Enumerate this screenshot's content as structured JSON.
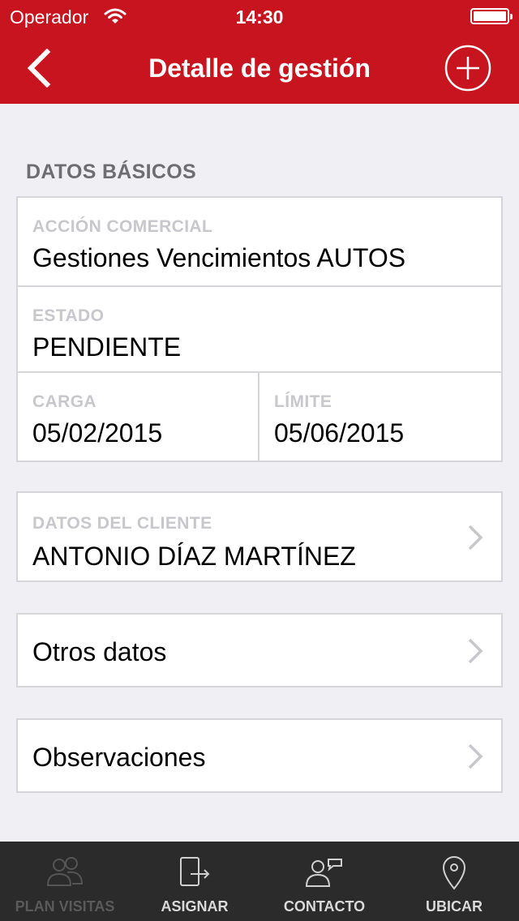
{
  "status_bar": {
    "carrier": "Operador",
    "time": "14:30"
  },
  "nav": {
    "title": "Detalle de gestión",
    "back_icon": "chevron-left-icon",
    "add_icon": "plus-circle-icon"
  },
  "section": {
    "title": "DATOS BÁSICOS"
  },
  "basic": {
    "action_label": "ACCIÓN COMERCIAL",
    "action_value": "Gestiones Vencimientos AUTOS",
    "state_label": "ESTADO",
    "state_value": "PENDIENTE",
    "load_label": "CARGA",
    "load_value": "05/02/2015",
    "limit_label": "LÍMITE",
    "limit_value": "05/06/2015"
  },
  "client": {
    "label": "DATOS DEL CLIENTE",
    "value": "ANTONIO DÍAZ MARTÍNEZ"
  },
  "other": {
    "label": "Otros datos"
  },
  "observations": {
    "label": "Observaciones"
  },
  "tabs": [
    {
      "label": "PLAN VISITAS",
      "icon": "people-icon",
      "enabled": false
    },
    {
      "label": "ASIGNAR",
      "icon": "assign-icon",
      "enabled": true
    },
    {
      "label": "CONTACTO",
      "icon": "contact-icon",
      "enabled": true
    },
    {
      "label": "UBICAR",
      "icon": "location-pin-icon",
      "enabled": true
    }
  ],
  "colors": {
    "brand": "#c8141e",
    "background": "#efeff4",
    "tab_bar": "#2b2b2b",
    "label_gray": "#c7c7cc"
  }
}
